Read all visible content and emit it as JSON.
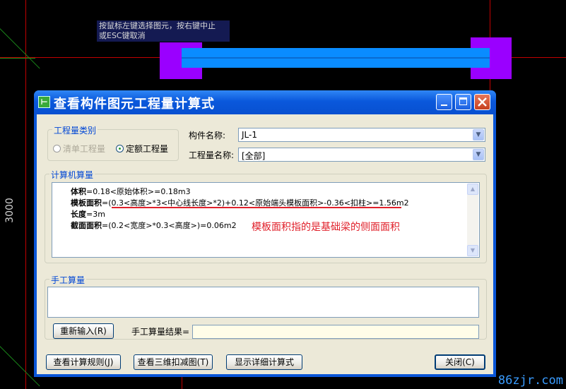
{
  "cad": {
    "tooltip_line1": "按鼠标左键选择图元，按右键中止",
    "tooltip_line2": "或ESC键取消",
    "dimension": "3000",
    "watermark": "86zjr.com"
  },
  "colors": {
    "beam": "#0a8cff",
    "column": "#9a00ff",
    "axis": "#c00000",
    "annotation": "#e0202a",
    "title_bar": "#0a58dc"
  },
  "dialog": {
    "title": "查看构件图元工程量计算式",
    "icon_glyph": "⊢",
    "minimize_icon": "minimize-icon",
    "maximize_icon": "maximize-icon",
    "close_icon": "close-icon",
    "quantity_type": {
      "label": "工程量类别",
      "option_list": "清单工程量",
      "option_quota": "定额工程量",
      "selected": "定额工程量"
    },
    "component_name": {
      "label": "构件名称:",
      "value": "JL-1"
    },
    "quantity_name": {
      "label": "工程量名称:",
      "value": "[全部]"
    },
    "computer_calc": {
      "label": "计算机算量",
      "lines": [
        {
          "name": "体积",
          "formula": "=0.18<原始体积>=0.18m3"
        },
        {
          "name": "模板面积",
          "formula": "=(0.3<高度>*3<中心线长度>*2)+0.12<原始端头模板面积>-0.36<扣柱>=1.56m2"
        },
        {
          "name": "长度",
          "formula": "=3m"
        },
        {
          "name": "截面面积",
          "formula": "=(0.2<宽度>*0.3<高度>)=0.06m2"
        }
      ],
      "annotation": "模板面积指的是基础梁的侧面面积"
    },
    "manual_calc": {
      "label": "手工算量",
      "reenter_button": "重新输入(R)",
      "result_label": "手工算量结果="
    },
    "buttons": {
      "view_rules": "查看计算规则(J)",
      "view_3d": "查看三维扣减图(T)",
      "show_detail": "显示详细计算式",
      "close": "关闭(C)"
    }
  }
}
